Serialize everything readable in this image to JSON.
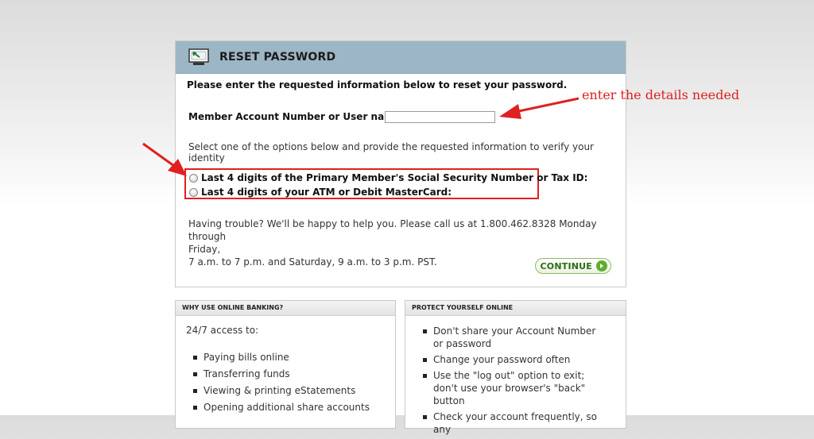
{
  "panel": {
    "title": "RESET PASSWORD",
    "header_icon": "computer-monitor-icon",
    "intro": "Please enter the requested information below to reset your password.",
    "account_label": "Member Account Number or User name:",
    "account_value": "",
    "select_text": "Select one of the options below and provide the requested information to verify your identity",
    "option1": "Last 4 digits of the Primary Member's Social Security Number or Tax ID:",
    "option2": "Last 4 digits of your ATM or Debit MasterCard:",
    "trouble_line1": "Having trouble? We'll be happy to help you. Please call us at 1.800.462.8328 Monday through",
    "trouble_line2": "Friday,",
    "trouble_line3": "7 a.m. to 7 p.m. and Saturday, 9 a.m. to 3 p.m. PST.",
    "continue_label": "CONTINUE",
    "continue_icon": "arrow-right-icon"
  },
  "annotation": {
    "text": "enter the details needed",
    "color": "#e02020"
  },
  "why": {
    "title": "WHY USE ONLINE BANKING?",
    "access": "24/7 access to:",
    "items": [
      "Paying bills online",
      "Transferring funds",
      "Viewing & printing eStatements",
      "Opening additional share accounts"
    ]
  },
  "protect": {
    "title": "PROTECT YOURSELF ONLINE",
    "items": [
      "Don't share your Account Number or password",
      "Change your password often",
      "Use the \"log out\" option to exit; don't use your browser's \"back\" button",
      "Check your account frequently, so any"
    ]
  },
  "colors": {
    "header_bg": "#9cb6c6",
    "continue_green": "#5fae2e",
    "annotation_red": "#e02020"
  }
}
